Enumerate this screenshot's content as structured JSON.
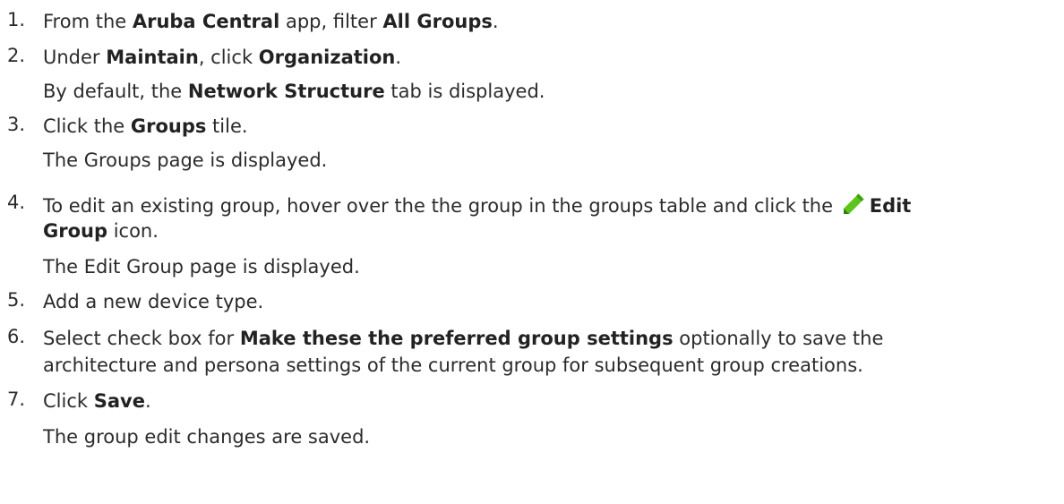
{
  "steps": [
    {
      "number": "1.",
      "lines": [
        {
          "t1": "From the ",
          "b1": "Aruba Central",
          "t2": " app, filter ",
          "b2": "All Groups",
          "t3": "."
        }
      ]
    },
    {
      "number": "2.",
      "lines": [
        {
          "t1": "Under ",
          "b1": "Maintain",
          "t2": ", click ",
          "b2": "Organization",
          "t3": "."
        },
        {
          "t1": "By default, the ",
          "b1": "Network Structure",
          "t2": " tab is displayed."
        }
      ]
    },
    {
      "number": "3.",
      "lines": [
        {
          "t1": "Click the ",
          "b1": "Groups",
          "t2": " tile."
        },
        {
          "t1": "The Groups page is displayed."
        }
      ]
    },
    {
      "number": "4.",
      "lines": [
        {
          "t1": "To edit an existing group, hover over the the group in the groups table and click the ",
          "icon": "pencil-edit-icon",
          "b1": "Edit"
        },
        {
          "b1": "Group",
          "t1": " icon."
        },
        {
          "t1": "The Edit Group page is displayed."
        }
      ]
    },
    {
      "number": "5.",
      "lines": [
        {
          "t1": "Add a new device type."
        }
      ]
    },
    {
      "number": "6.",
      "lines": [
        {
          "t1": "Select check box for ",
          "b1": "Make these the preferred group settings",
          "t2": " optionally to save the"
        },
        {
          "t1": "architecture and persona settings of the current group for subsequent group creations."
        }
      ]
    },
    {
      "number": "7.",
      "lines": [
        {
          "t1": "Click ",
          "b1": "Save",
          "t2": "."
        },
        {
          "t1": "The group edit changes are saved."
        }
      ]
    }
  ],
  "colors": {
    "text": "#2b2b2b",
    "icon_green": "#5cc41f"
  }
}
